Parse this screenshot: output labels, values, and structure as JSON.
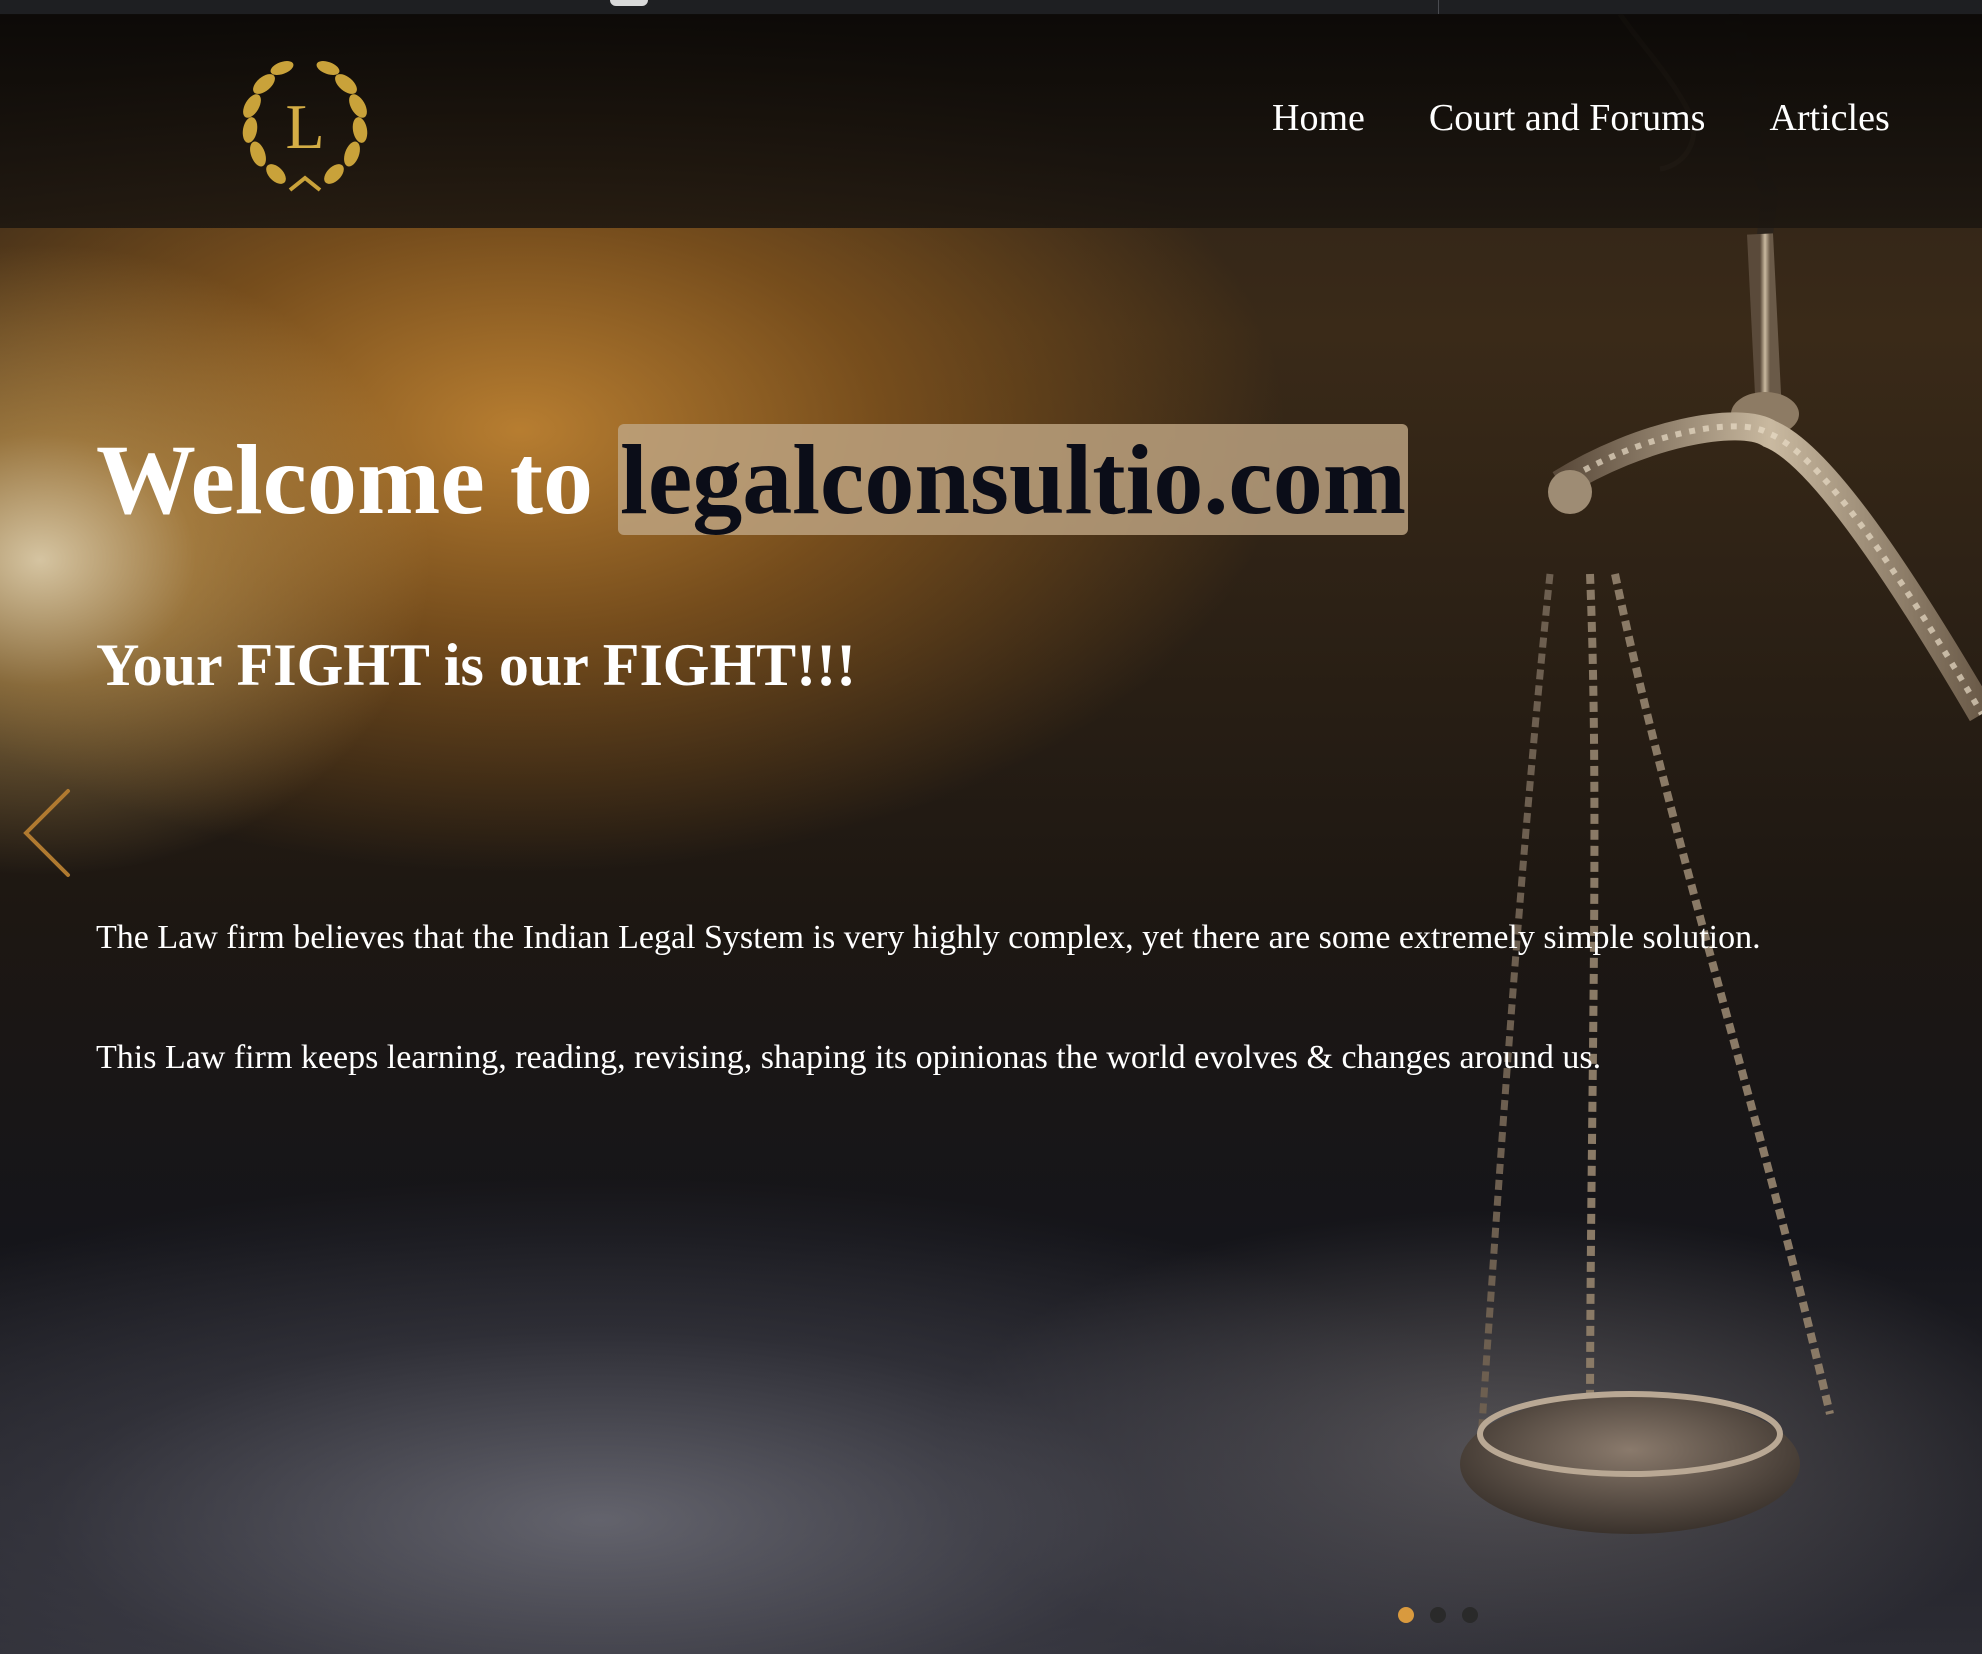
{
  "header": {
    "logo_letter": "L",
    "nav": [
      {
        "label": "Home"
      },
      {
        "label": "Court and Forums"
      },
      {
        "label": "Articles"
      }
    ]
  },
  "hero": {
    "title_prefix": "Welcome to ",
    "title_highlight": "legalconsultio.com",
    "subtitle": "Your FIGHT is our FIGHT!!!",
    "paragraphs": [
      "The Law firm believes that the Indian Legal System is very highly complex, yet there are some extremely simple solution.",
      "This Law firm keeps learning, reading, revising, shaping its opinionas the world evolves & changes around us."
    ]
  },
  "carousel": {
    "prev_icon": "chevron-left-icon",
    "slide_count": 3,
    "active_slide": 1
  },
  "colors": {
    "accent_gold": "#d99a3e",
    "logo_gold": "#c9a23a",
    "highlight_bg": "#bea582"
  }
}
